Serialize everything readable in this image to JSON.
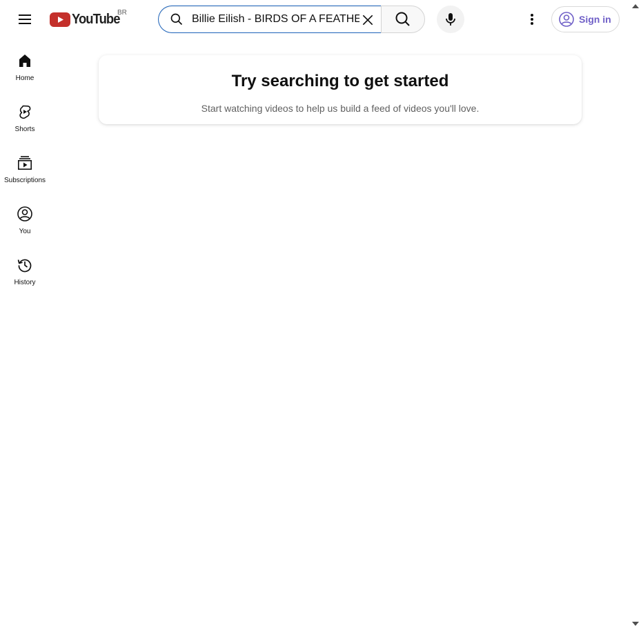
{
  "header": {
    "logo_text": "YouTube",
    "country_code": "BR",
    "search": {
      "value": "Billie Eilish - BIRDS OF A FEATHER"
    },
    "sign_in_label": "Sign in"
  },
  "sidebar": {
    "items": [
      {
        "label": "Home",
        "icon": "home-icon"
      },
      {
        "label": "Shorts",
        "icon": "shorts-icon"
      },
      {
        "label": "Subscriptions",
        "icon": "subscriptions-icon"
      },
      {
        "label": "You",
        "icon": "you-icon"
      },
      {
        "label": "History",
        "icon": "history-icon"
      }
    ]
  },
  "main": {
    "card_title": "Try searching to get started",
    "card_subtitle": "Start watching videos to help us build a feed of videos you'll love."
  },
  "colors": {
    "brand_red": "#ff0000",
    "search_focus_border": "#1c62b9",
    "sign_in_accent": "#6f5fc7"
  }
}
